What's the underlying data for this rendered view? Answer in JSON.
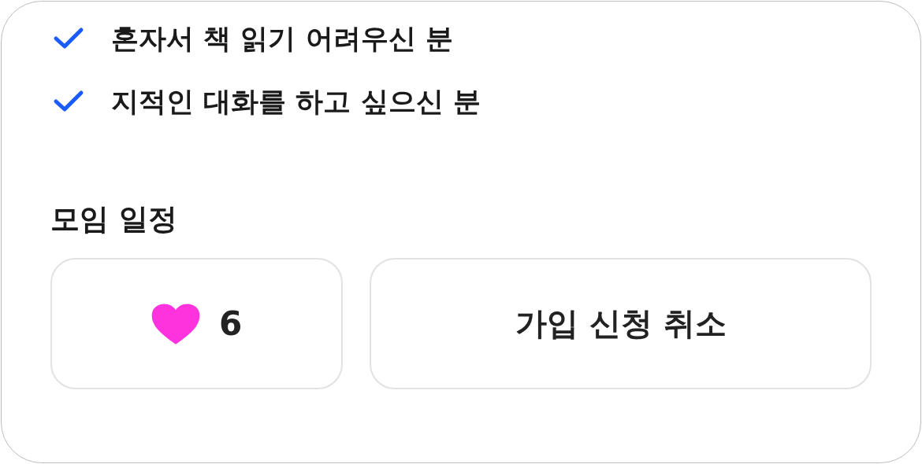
{
  "checklist": [
    {
      "text": "혼자서 책 읽기 어려우신 분",
      "checked": true
    },
    {
      "text": "지적인 대화를 하고 싶으신 분",
      "checked": true
    }
  ],
  "section_title": "모임 일정",
  "like_button": {
    "count": "6",
    "liked": true
  },
  "action_button": {
    "label": "가입 신청 취소"
  }
}
